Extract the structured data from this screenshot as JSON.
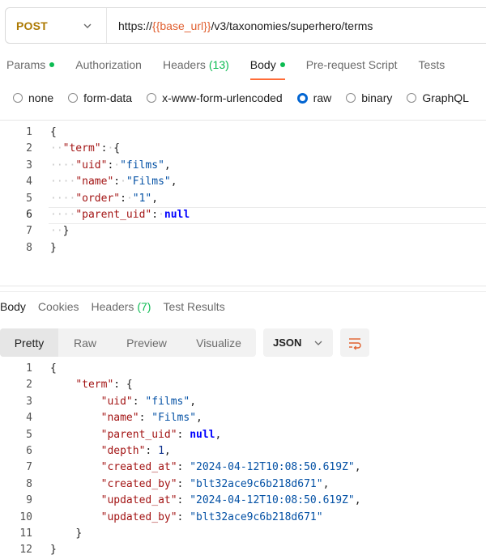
{
  "request": {
    "method": "POST",
    "url_prefix": "https://",
    "url_variable": "{{base_url}}",
    "url_suffix": "/v3/taxonomies/superhero/terms"
  },
  "request_tabs": [
    {
      "label": "Params",
      "dot": true
    },
    {
      "label": "Authorization"
    },
    {
      "label": "Headers",
      "count": "(13)"
    },
    {
      "label": "Body",
      "dot": true,
      "active": true
    },
    {
      "label": "Pre-request Script"
    },
    {
      "label": "Tests"
    }
  ],
  "body_types": [
    {
      "label": "none"
    },
    {
      "label": "form-data"
    },
    {
      "label": "x-www-form-urlencoded"
    },
    {
      "label": "raw",
      "checked": true
    },
    {
      "label": "binary"
    },
    {
      "label": "GraphQL"
    }
  ],
  "request_body": [
    {
      "ln": "1",
      "parts": [
        [
          "p",
          "{"
        ]
      ]
    },
    {
      "ln": "2",
      "parts": [
        [
          "ws",
          "··"
        ],
        [
          "k",
          "\"term\""
        ],
        [
          "p",
          ":"
        ],
        [
          "ws",
          "·"
        ],
        [
          "p",
          "{"
        ]
      ]
    },
    {
      "ln": "3",
      "parts": [
        [
          "ws",
          "····"
        ],
        [
          "k",
          "\"uid\""
        ],
        [
          "p",
          ":"
        ],
        [
          "ws",
          "·"
        ],
        [
          "s",
          "\"films\""
        ],
        [
          "p",
          ","
        ]
      ]
    },
    {
      "ln": "4",
      "parts": [
        [
          "ws",
          "····"
        ],
        [
          "k",
          "\"name\""
        ],
        [
          "p",
          ":"
        ],
        [
          "ws",
          "·"
        ],
        [
          "s",
          "\"Films\""
        ],
        [
          "p",
          ","
        ]
      ]
    },
    {
      "ln": "5",
      "parts": [
        [
          "ws",
          "····"
        ],
        [
          "k",
          "\"order\""
        ],
        [
          "p",
          ":"
        ],
        [
          "ws",
          "·"
        ],
        [
          "s",
          "\"1\""
        ],
        [
          "p",
          ","
        ]
      ]
    },
    {
      "ln": "6",
      "active": true,
      "parts": [
        [
          "ws",
          "····"
        ],
        [
          "k",
          "\"parent_uid\""
        ],
        [
          "p",
          ":"
        ],
        [
          "ws",
          "·"
        ],
        [
          "nl",
          "null"
        ]
      ]
    },
    {
      "ln": "7",
      "parts": [
        [
          "ws",
          "··"
        ],
        [
          "p",
          "}"
        ]
      ]
    },
    {
      "ln": "8",
      "parts": [
        [
          "p",
          "}"
        ]
      ]
    }
  ],
  "response_tabs": [
    {
      "label": "Body",
      "active": true
    },
    {
      "label": "Cookies"
    },
    {
      "label": "Headers",
      "count": "(7)"
    },
    {
      "label": "Test Results"
    }
  ],
  "view_modes": [
    {
      "label": "Pretty",
      "active": true
    },
    {
      "label": "Raw"
    },
    {
      "label": "Preview"
    },
    {
      "label": "Visualize"
    }
  ],
  "format": {
    "label": "JSON"
  },
  "response_body": [
    {
      "ln": "1",
      "parts": [
        [
          "p",
          "{"
        ]
      ]
    },
    {
      "ln": "2",
      "parts": [
        [
          "p",
          "    "
        ],
        [
          "k",
          "\"term\""
        ],
        [
          "p",
          ": {"
        ]
      ]
    },
    {
      "ln": "3",
      "parts": [
        [
          "p",
          "        "
        ],
        [
          "k",
          "\"uid\""
        ],
        [
          "p",
          ": "
        ],
        [
          "s",
          "\"films\""
        ],
        [
          "p",
          ","
        ]
      ]
    },
    {
      "ln": "4",
      "parts": [
        [
          "p",
          "        "
        ],
        [
          "k",
          "\"name\""
        ],
        [
          "p",
          ": "
        ],
        [
          "s",
          "\"Films\""
        ],
        [
          "p",
          ","
        ]
      ]
    },
    {
      "ln": "5",
      "parts": [
        [
          "p",
          "        "
        ],
        [
          "k",
          "\"parent_uid\""
        ],
        [
          "p",
          ": "
        ],
        [
          "nl",
          "null"
        ],
        [
          "p",
          ","
        ]
      ]
    },
    {
      "ln": "6",
      "parts": [
        [
          "p",
          "        "
        ],
        [
          "k",
          "\"depth\""
        ],
        [
          "p",
          ": "
        ],
        [
          "n2",
          "1"
        ],
        [
          "p",
          ","
        ]
      ]
    },
    {
      "ln": "7",
      "parts": [
        [
          "p",
          "        "
        ],
        [
          "k",
          "\"created_at\""
        ],
        [
          "p",
          ": "
        ],
        [
          "s",
          "\"2024-04-12T10:08:50.619Z\""
        ],
        [
          "p",
          ","
        ]
      ]
    },
    {
      "ln": "8",
      "parts": [
        [
          "p",
          "        "
        ],
        [
          "k",
          "\"created_by\""
        ],
        [
          "p",
          ": "
        ],
        [
          "s",
          "\"blt32ace9c6b218d671\""
        ],
        [
          "p",
          ","
        ]
      ]
    },
    {
      "ln": "9",
      "parts": [
        [
          "p",
          "        "
        ],
        [
          "k",
          "\"updated_at\""
        ],
        [
          "p",
          ": "
        ],
        [
          "s",
          "\"2024-04-12T10:08:50.619Z\""
        ],
        [
          "p",
          ","
        ]
      ]
    },
    {
      "ln": "10",
      "parts": [
        [
          "p",
          "        "
        ],
        [
          "k",
          "\"updated_by\""
        ],
        [
          "p",
          ": "
        ],
        [
          "s",
          "\"blt32ace9c6b218d671\""
        ]
      ]
    },
    {
      "ln": "11",
      "parts": [
        [
          "p",
          "    "
        ],
        [
          "p",
          "}"
        ]
      ]
    },
    {
      "ln": "12",
      "parts": [
        [
          "p",
          "}"
        ]
      ]
    }
  ],
  "colors": {
    "accent": "#ff6c37",
    "method": "#ad7a03",
    "variable": "#e05e2e",
    "success": "#0cbb52",
    "radio": "#0265d2"
  }
}
